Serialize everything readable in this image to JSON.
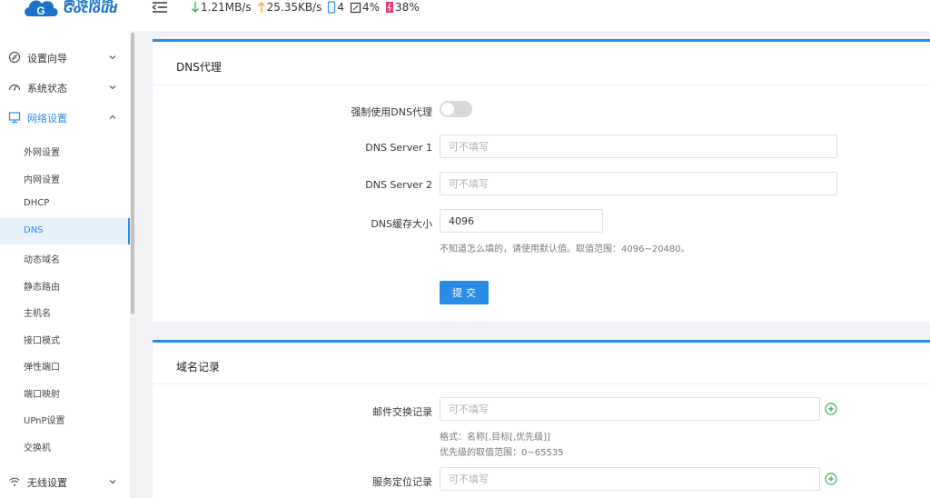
{
  "logo": {
    "cn": "高恪网络",
    "en": "Gocloud"
  },
  "sidebar": {
    "groups": [
      {
        "label": "设置向导",
        "icon": "compass-icon"
      },
      {
        "label": "系统状态",
        "icon": "gauge-icon"
      },
      {
        "label": "网络设置",
        "icon": "monitor-icon"
      },
      {
        "label": "无线设置",
        "icon": "wifi-icon"
      }
    ],
    "items": [
      {
        "label": "外网设置"
      },
      {
        "label": "内网设置"
      },
      {
        "label": "DHCP"
      },
      {
        "label": "DNS"
      },
      {
        "label": "动态域名"
      },
      {
        "label": "静态路由"
      },
      {
        "label": "主机名"
      },
      {
        "label": "接口模式"
      },
      {
        "label": "弹性端口"
      },
      {
        "label": "端口映射"
      },
      {
        "label": "UPnP设置"
      },
      {
        "label": "交换机"
      }
    ],
    "active_group": "网络设置",
    "selected_item": "DNS"
  },
  "topbar": {
    "download": "1.21MB/s",
    "upload": "25.35KB/s",
    "devices": "4",
    "cpu": "4%",
    "memory": "38%"
  },
  "colors": {
    "accent": "#2b8ce8",
    "download": "#3aa757",
    "upload": "#f0a020",
    "memory": "#e23b7a",
    "plus": "#3aa757"
  },
  "dns_proxy": {
    "title": "DNS代理",
    "force_label": "强制使用DNS代理",
    "force_enabled": false,
    "server1_label": "DNS Server 1",
    "server1_placeholder": "可不填写",
    "server2_label": "DNS Server 2",
    "server2_placeholder": "可不填写",
    "cache_label": "DNS缓存大小",
    "cache_value": "4096",
    "cache_hint": "不知道怎么填的，请使用默认值。取值范围：4096~20480。",
    "submit_label": "提交"
  },
  "domain_records": {
    "title": "域名记录",
    "mx_label": "邮件交换记录",
    "mx_placeholder": "可不填写",
    "mx_hint1": "格式：名称[,目标[,优先级]]",
    "mx_hint2": "优先级的取值范围：0~65535",
    "srv_label": "服务定位记录",
    "srv_placeholder": "可不填写"
  }
}
